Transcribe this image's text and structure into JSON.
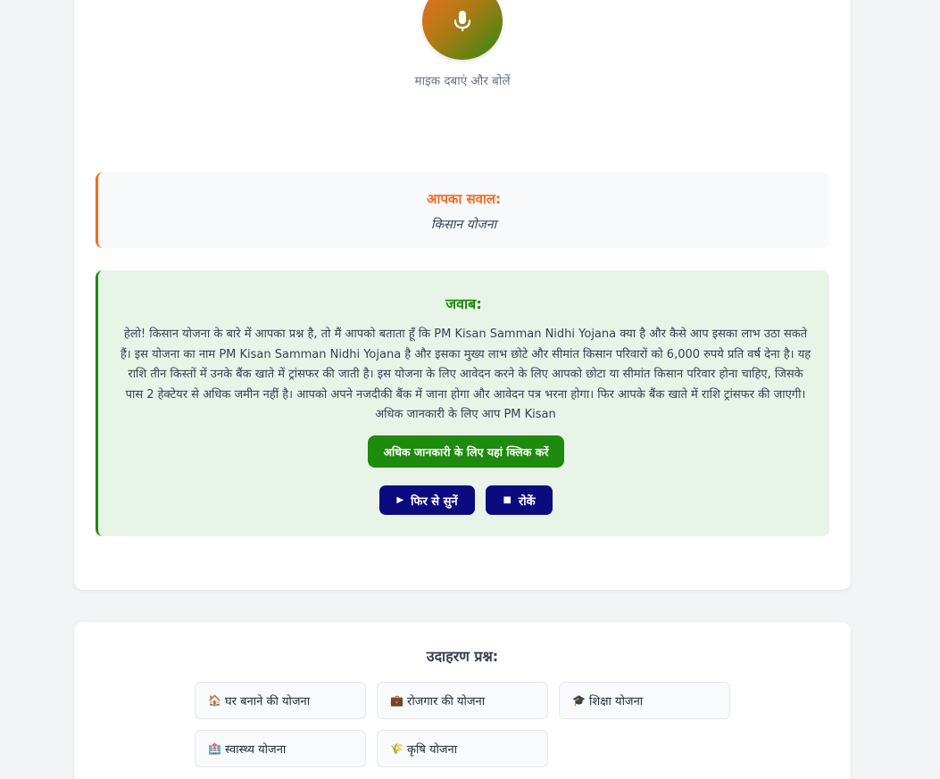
{
  "voice": {
    "mic_hint": "माइक दबाएं और बोलें",
    "mic_icon": "microphone-icon"
  },
  "question": {
    "title": "आपका सवाल:",
    "text": "किसान योजना"
  },
  "answer": {
    "title": "जवाब:",
    "text": "हेलो! किसान योजना के बारे में आपका प्रश्न है, तो मैं आपको बताता हूँ कि PM Kisan Samman Nidhi Yojana क्या है और कैसे आप इसका लाभ उठा सकते हैं। इस योजना का नाम PM Kisan Samman Nidhi Yojana है और इसका मुख्य लाभ छोटे और सीमांत किसान परिवारों को 6,000 रुपये प्रति वर्ष देना है। यह राशि तीन किस्तों में उनके बैंक खाते में ट्रांसफर की जाती है। इस योजना के लिए आवेदन करने के लिए आपको छोटा या सीमांत किसान परिवार होना चाहिए, जिसके पास 2 हेक्टेयर से अधिक जमीन नहीं है। आपको अपने नजदीकी बैंक में जाना होगा और आवेदन पत्र भरना होगा। फिर आपके बैंक खाते में राशि ट्रांसफर की जाएगी। अधिक जानकारी के लिए आप PM Kisan",
    "info_button": "अधिक जानकारी के लिए यहां क्लिक करें",
    "replay_button": "फिर से सुनें",
    "stop_button": "रोकें",
    "replay_icon": "▶",
    "stop_icon": "■"
  },
  "examples": {
    "title": "उदाहरण प्रश्न:",
    "items": [
      {
        "label": "घर बनाने की योजना",
        "icon": "🏠"
      },
      {
        "label": "रोजगार की योजना",
        "icon": "💼"
      },
      {
        "label": "शिक्षा योजना",
        "icon": "🎓"
      },
      {
        "label": "स्वास्थ्य योजना",
        "icon": "🏥"
      },
      {
        "label": "कृषि योजना",
        "icon": "🌾"
      }
    ]
  },
  "colors": {
    "accent_orange": "#f26c22",
    "accent_green": "#1e8a0e",
    "button_navy": "#0c0a7e"
  }
}
